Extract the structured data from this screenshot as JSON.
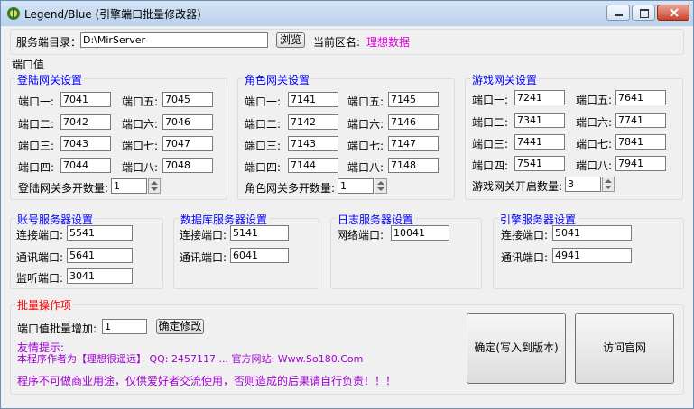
{
  "window": {
    "title": "Legend/Blue (引擎端口批量修改器)"
  },
  "server": {
    "dir_label": "服务端目录：",
    "dir_value": "D:\\MirServer",
    "browse_label": "浏览",
    "zone_label": "当前区名:",
    "zone_value": "理想数据"
  },
  "ports_section": {
    "title": "端口值"
  },
  "login_gate": {
    "title": "登陆网关设置",
    "ports": [
      {
        "label": "端口一:",
        "value": "7041"
      },
      {
        "label": "端口五:",
        "value": "7045"
      },
      {
        "label": "端口二:",
        "value": "7042"
      },
      {
        "label": "端口六:",
        "value": "7046"
      },
      {
        "label": "端口三:",
        "value": "7043"
      },
      {
        "label": "端口七:",
        "value": "7047"
      },
      {
        "label": "端口四:",
        "value": "7044"
      },
      {
        "label": "端口八:",
        "value": "7048"
      }
    ],
    "count_label": "登陆网关多开数量:",
    "count_value": "1"
  },
  "role_gate": {
    "title": "角色网关设置",
    "ports": [
      {
        "label": "端口一:",
        "value": "7141"
      },
      {
        "label": "端口五:",
        "value": "7145"
      },
      {
        "label": "端口二:",
        "value": "7142"
      },
      {
        "label": "端口六:",
        "value": "7146"
      },
      {
        "label": "端口三:",
        "value": "7143"
      },
      {
        "label": "端口七:",
        "value": "7147"
      },
      {
        "label": "端口四:",
        "value": "7144"
      },
      {
        "label": "端口八:",
        "value": "7148"
      }
    ],
    "count_label": "角色网关多开数量:",
    "count_value": "1"
  },
  "game_gate": {
    "title": "游戏网关设置",
    "ports": [
      {
        "label": "端口一:",
        "value": "7241"
      },
      {
        "label": "端口五:",
        "value": "7641"
      },
      {
        "label": "端口二:",
        "value": "7341"
      },
      {
        "label": "端口六:",
        "value": "7741"
      },
      {
        "label": "端口三:",
        "value": "7441"
      },
      {
        "label": "端口七:",
        "value": "7841"
      },
      {
        "label": "端口四:",
        "value": "7541"
      },
      {
        "label": "端口八:",
        "value": "7941"
      }
    ],
    "count_label": "游戏网关开启数量:",
    "count_value": "3"
  },
  "account_server": {
    "title": "账号服务器设置",
    "connect_label": "连接端口:",
    "connect_value": "5541",
    "comm_label": "通讯端口:",
    "comm_value": "5641",
    "listen_label": "监听端口:",
    "listen_value": "3041"
  },
  "db_server": {
    "title": "数据库服务器设置",
    "connect_label": "连接端口:",
    "connect_value": "5141",
    "comm_label": "通讯端口:",
    "comm_value": "6041"
  },
  "log_server": {
    "title": "日志服务器设置",
    "net_label": "网络端口:",
    "net_value": "10041"
  },
  "engine_server": {
    "title": "引擎服务器设置",
    "connect_label": "连接端口:",
    "connect_value": "5041",
    "comm_label": "通讯端口:",
    "comm_value": "4941"
  },
  "batch": {
    "title": "批量操作项",
    "increment_label": "端口值批量增加:",
    "increment_value": "1",
    "confirm_edit_label": "确定修改",
    "tip_title": "友情提示:",
    "tip_line": "本程序作者为【理想很遥远】 QQ: 2457117 ...    官方网站: Www.So180.Com",
    "warning": "程序不可做商业用途，仅供爱好者交流使用，否则造成的后果请自行负责！！！",
    "confirm_write_label": "确定(写入到版本)",
    "visit_site_label": "访问官网"
  },
  "colors": {
    "group_title": "#0000ff",
    "zone": "#e000e0",
    "batch_title": "#ff0000",
    "tip": "#a000d0"
  }
}
